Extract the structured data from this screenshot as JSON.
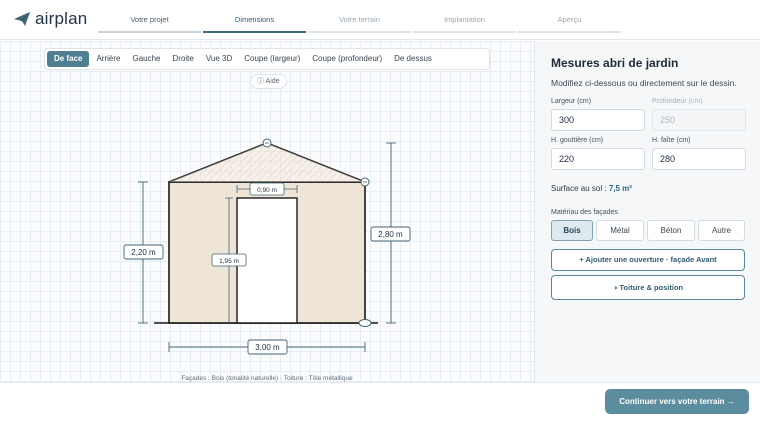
{
  "app": {
    "logo_text": "airplan"
  },
  "steps": [
    {
      "label": "Votre projet"
    },
    {
      "label": "Dimensions"
    },
    {
      "label": "Votre terrain"
    },
    {
      "label": "Implantation"
    },
    {
      "label": "Aperçu"
    }
  ],
  "view_tabs": [
    "De face",
    "Arrière",
    "Gauche",
    "Droite",
    "Vue 3D",
    "Coupe (largeur)",
    "Coupe (profondeur)",
    "De dessus"
  ],
  "help": {
    "label": "ⓘ Aide"
  },
  "drawing": {
    "width_label": "3,00 m",
    "left_height_label": "2,20 m",
    "right_height_label": "2,80 m",
    "door_width_label": "0,90 m",
    "door_height_label": "1,95 m",
    "caption": "Façades : Bois (tonalité naturelle) · Toiture : Tôle métallique",
    "colors": {
      "wall": "#efe5d6",
      "stroke": "#1a1a1a",
      "dim": "#3f6577"
    }
  },
  "panel": {
    "title": "Mesures abri de jardin",
    "subtitle": "Modifiez ci-dessous ou directement sur le dessin.",
    "fields": {
      "largeur": {
        "label": "Largeur (cm)",
        "value": "300"
      },
      "profondeur": {
        "label": "Profondeur (cm)",
        "value": "250"
      },
      "gouttiere": {
        "label": "H. gouttière (cm)",
        "value": "220"
      },
      "faite": {
        "label": "H. faîte (cm)",
        "value": "280"
      }
    },
    "surface": {
      "label": "Surface au sol :",
      "value": "7,5 m²"
    },
    "material_label": "Matériau des façades",
    "materials": [
      "Bois",
      "Métal",
      "Béton",
      "Autre"
    ],
    "add_opening": "+ Ajouter une ouverture · façade Avant",
    "roof_button": "◑ Toiture & position"
  },
  "footer": {
    "cta": "Continuer vers votre terrain →"
  },
  "colors": {
    "accent": "#5c8d9e",
    "accent_dark": "#3b6b80"
  }
}
